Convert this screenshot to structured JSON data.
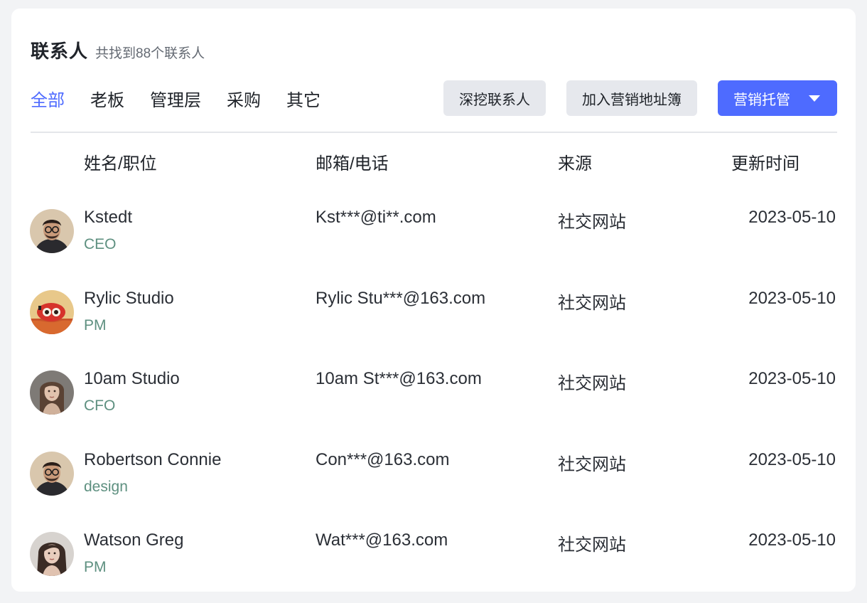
{
  "header": {
    "title": "联系人",
    "subtitle": "共找到88个联系人"
  },
  "tabs": [
    {
      "label": "全部",
      "active": true
    },
    {
      "label": "老板",
      "active": false
    },
    {
      "label": "管理层",
      "active": false
    },
    {
      "label": "采购",
      "active": false
    },
    {
      "label": "其它",
      "active": false
    }
  ],
  "actions": {
    "dig_label": "深挖联系人",
    "add_book_label": "加入营销地址簿",
    "marketing_label": "营销托管"
  },
  "colors": {
    "accent": "#4e6bff",
    "role_text": "#5e9080",
    "button_gray": "#e6e8ed"
  },
  "table": {
    "columns": [
      "姓名/职位",
      "邮箱/电话",
      "来源",
      "更新时间"
    ],
    "rows": [
      {
        "name": "Kstedt",
        "role": "CEO",
        "contact": "Kst***@ti**.com",
        "source": "社交网站",
        "updated": "2023-05-10",
        "avatar": "man-glasses-avatar"
      },
      {
        "name": "Rylic Studio",
        "role": "PM",
        "contact": "Rylic Stu***@163.com",
        "source": "社交网站",
        "updated": "2023-05-10",
        "avatar": "red-robot-avatar"
      },
      {
        "name": "10am Studio",
        "role": "CFO",
        "contact": "10am St***@163.com",
        "source": "社交网站",
        "updated": "2023-05-10",
        "avatar": "woman-long-hair-avatar"
      },
      {
        "name": "Robertson Connie",
        "role": "design",
        "contact": "Con***@163.com",
        "source": "社交网站",
        "updated": "2023-05-10",
        "avatar": "man-glasses-avatar"
      },
      {
        "name": "Watson Greg",
        "role": "PM",
        "contact": "Wat***@163.com",
        "source": "社交网站",
        "updated": "2023-05-10",
        "avatar": "woman-portrait-avatar"
      }
    ]
  }
}
